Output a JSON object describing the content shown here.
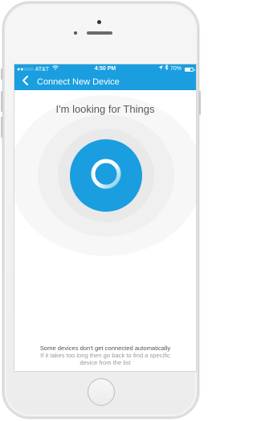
{
  "status_bar": {
    "signal_text": "●●○○○ AT&T",
    "wifi_icon": "wifi-icon",
    "time": "4:50 PM",
    "location_icon": "location-arrow-icon",
    "bluetooth_icon": "bluetooth-icon",
    "battery_percent": "70%",
    "battery_level": 0.7
  },
  "nav": {
    "back_icon": "chevron-left-icon",
    "title": "Connect New Device"
  },
  "main": {
    "heading": "I'm looking for Things",
    "scan_icon": "scanning-ring-icon"
  },
  "footer": {
    "line1": "Some devices don't get connected automatically",
    "line2": "If it takes too long then go back to find a specific",
    "line3": "device from the list"
  },
  "colors": {
    "accent": "#1a9ee0",
    "heading_text": "#5a5a5a",
    "hint_text": "#9a9a9a"
  }
}
